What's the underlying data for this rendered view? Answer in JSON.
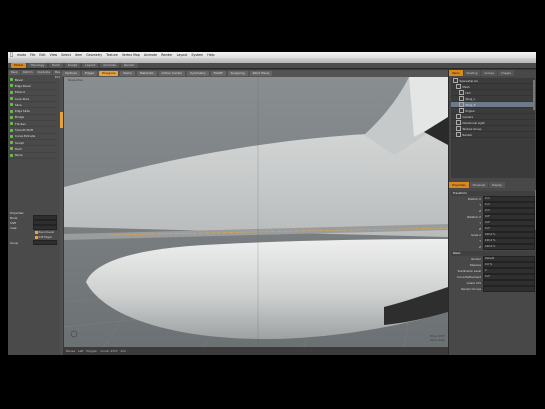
{
  "menubar": {
    "apple": "",
    "items": [
      "modo",
      "File",
      "Edit",
      "View",
      "Select",
      "Item",
      "Geometry",
      "Texture",
      "Vertex Map",
      "Animate",
      "Render",
      "Layout",
      "System",
      "Help"
    ]
  },
  "window": {
    "title": "Spaceship.lxo - modo"
  },
  "mode_tabs": [
    "Model",
    "Topology",
    "Paint",
    "Sculpt",
    "Layout",
    "Animate",
    "Render"
  ],
  "toolbar": {
    "buttons": [
      "Vertices",
      "Edges",
      "Polygons",
      "Items",
      "Materials",
      "Action Center",
      "Symmetry",
      "Falloff",
      "Snapping",
      "Work Plane"
    ]
  },
  "tools": {
    "tabs": [
      "Basic",
      "Deform",
      "Duplicate",
      "Mesh Edit",
      "Vertex"
    ],
    "items": [
      "Bevel",
      "Edge Bevel",
      "Extend",
      "Loop Slice",
      "Slice",
      "Edge Slide",
      "Bridge",
      "Thicken",
      "Smooth Shift",
      "Curve Extrude",
      "Sculpt",
      "Push",
      "Move"
    ]
  },
  "tool_props": {
    "header": "Properties",
    "rows": [
      {
        "label": "Mode",
        "value": ""
      },
      {
        "label": "Shift",
        "value": ""
      },
      {
        "label": "Inset",
        "value": ""
      },
      {
        "label": "Group",
        "value": ""
      }
    ],
    "checks": [
      "Round Level",
      "Soft Edges"
    ]
  },
  "viewport": {
    "label": "Perspective",
    "status": [
      "Mouse",
      "Left",
      "Polygon",
      "Count: 4337",
      "Info"
    ],
    "corner": [
      "Polys: 4337",
      "Verts: 4412"
    ]
  },
  "scene": {
    "tabs": [
      "Items",
      "Shading",
      "Groups",
      "Images"
    ],
    "items": [
      {
        "label": "Spaceship.lxo",
        "selected": false
      },
      {
        "label": "Mesh",
        "selected": false
      },
      {
        "label": "Hull",
        "selected": false
      },
      {
        "label": "Wing_L",
        "selected": false
      },
      {
        "label": "Wing_R",
        "selected": true
      },
      {
        "label": "Engine",
        "selected": false
      },
      {
        "label": "Camera",
        "selected": false
      },
      {
        "label": "Directional Light",
        "selected": false
      },
      {
        "label": "Texture Group",
        "selected": false
      },
      {
        "label": "Render",
        "selected": false
      }
    ]
  },
  "properties": {
    "tabs": [
      "Properties",
      "Channels",
      "Display"
    ],
    "groups": [
      {
        "title": "Transform",
        "rows": [
          {
            "label": "Position X",
            "value": "0 m"
          },
          {
            "label": "Y",
            "value": "0 m"
          },
          {
            "label": "Z",
            "value": "0 m"
          },
          {
            "label": "Rotation X",
            "value": "0.0°"
          },
          {
            "label": "Y",
            "value": "0.0°"
          },
          {
            "label": "Z",
            "value": "0.0°"
          },
          {
            "label": "Scale X",
            "value": "100.0 %"
          },
          {
            "label": "Y",
            "value": "100.0 %"
          },
          {
            "label": "Z",
            "value": "100.0 %"
          }
        ]
      },
      {
        "title": "Mesh",
        "rows": [
          {
            "label": "Render",
            "value": "Default"
          },
          {
            "label": "Dissolve",
            "value": "0.0 %"
          },
          {
            "label": "Subdivision Level",
            "value": "2"
          },
          {
            "label": "Curve Refinement",
            "value": "5.0°"
          },
          {
            "label": "Linear UVs",
            "value": ""
          },
          {
            "label": "Render Curves",
            "value": ""
          }
        ]
      }
    ]
  },
  "colors": {
    "accent": "#d98a1e",
    "panel": "#4a4a4a",
    "viewport_bg": "#7a7f82",
    "model": "#d7d7d7"
  }
}
